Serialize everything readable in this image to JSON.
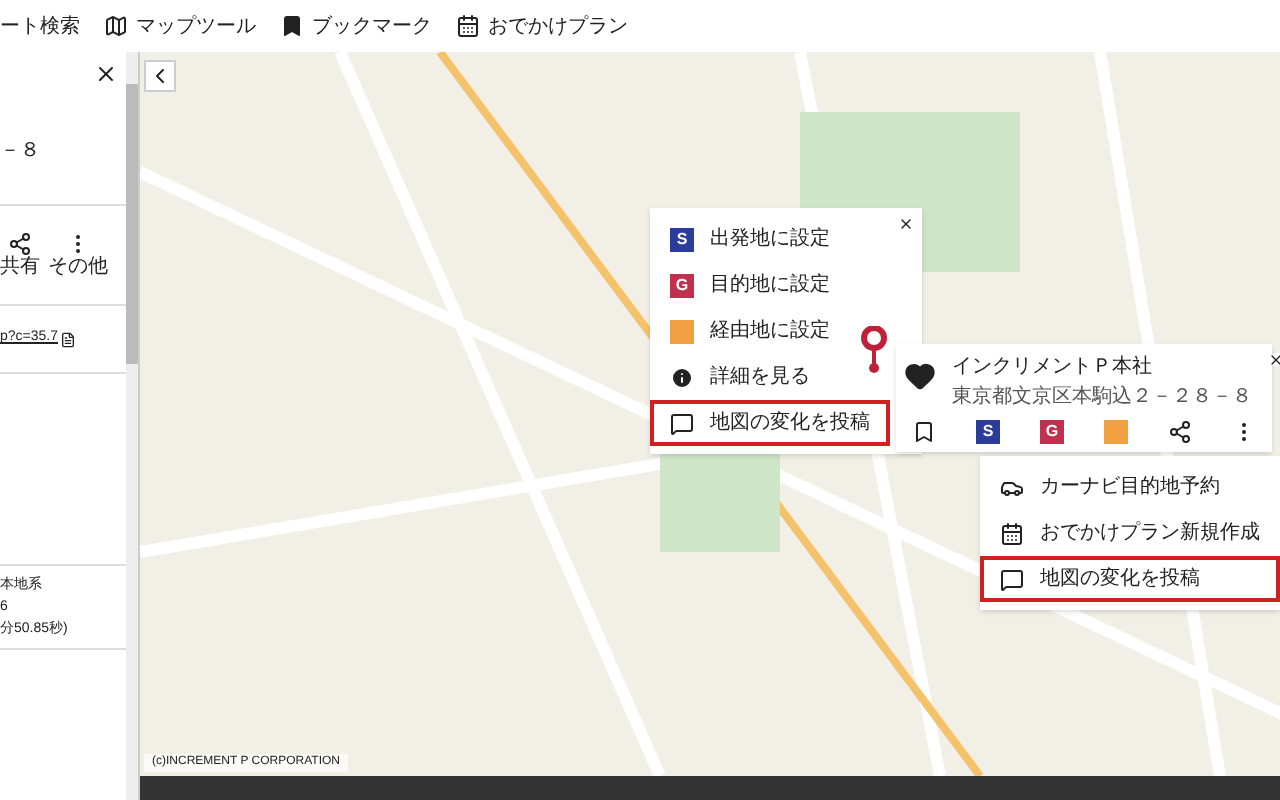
{
  "toolbar": [
    {
      "kind": "route",
      "label": "ート検索"
    },
    {
      "kind": "map",
      "label": "マップツール"
    },
    {
      "kind": "bookmark",
      "label": "ブックマーク"
    },
    {
      "kind": "calendar",
      "label": "おでかけプラン"
    }
  ],
  "side_panel": {
    "address_tail": "－８",
    "actions": [
      {
        "kind": "share",
        "label": "共有"
      },
      {
        "kind": "more",
        "label": "その他"
      }
    ],
    "url": "p?c=35.7",
    "info_lines": [
      "本地系",
      "6",
      "分50.85秒)"
    ]
  },
  "context_menu": {
    "items": [
      {
        "kind": "S",
        "badge": "S",
        "label": "出発地に設定",
        "highlighted": false
      },
      {
        "kind": "G",
        "badge": "G",
        "label": "目的地に設定",
        "highlighted": false
      },
      {
        "kind": "via",
        "label": "経由地に設定",
        "highlighted": false
      },
      {
        "kind": "info",
        "label": "詳細を見る",
        "highlighted": false
      },
      {
        "kind": "post",
        "label": "地図の変化を投稿",
        "highlighted": true
      }
    ]
  },
  "place_popup": {
    "name": "インクリメントＰ本社",
    "address": "東京都文京区本駒込２－２８－８",
    "buttons": [
      {
        "kind": "bookmark"
      },
      {
        "kind": "S",
        "badge": "S"
      },
      {
        "kind": "G",
        "badge": "G"
      },
      {
        "kind": "via"
      },
      {
        "kind": "share"
      },
      {
        "kind": "more"
      }
    ]
  },
  "more_menu": {
    "items": [
      {
        "kind": "car",
        "label": "カーナビ目的地予約",
        "highlighted": false
      },
      {
        "kind": "calendar",
        "label": "おでかけプラン新規作成",
        "highlighted": false
      },
      {
        "kind": "post",
        "label": "地図の変化を投稿",
        "highlighted": true
      }
    ]
  },
  "copyright": "(c)INCREMENT P CORPORATION"
}
